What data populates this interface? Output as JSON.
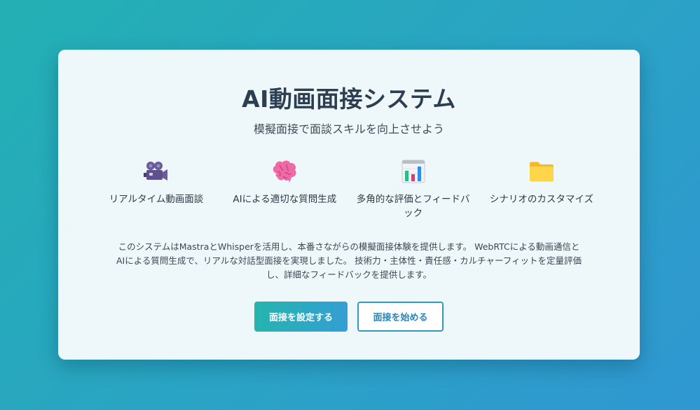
{
  "hero": {
    "title": "AI動画面接システム",
    "subtitle": "模擬面接で面談スキルを向上させよう"
  },
  "features": [
    {
      "icon": "movie-camera-icon",
      "label": "リアルタイム動画面談"
    },
    {
      "icon": "brain-icon",
      "label": "AIによる適切な質問生成"
    },
    {
      "icon": "bar-chart-icon",
      "label": "多角的な評価とフィードバック"
    },
    {
      "icon": "folder-icon",
      "label": "シナリオのカスタマイズ"
    }
  ],
  "description": "このシステムはMastraとWhisperを活用し、本番さながらの模擬面接体験を提供します。 WebRTCによる動画通信とAIによる質問生成で、リアルな対話型面接を実現しました。 技術力・主体性・責任感・カルチャーフィットを定量評価し、詳細なフィードバックを提供します。",
  "actions": {
    "configure_label": "面接を設定する",
    "start_label": "面接を始める"
  },
  "colors": {
    "background_start": "#23b0b3",
    "background_end": "#2f97d1",
    "card": "#eef8fb",
    "title": "#2c3e50",
    "primary_button_start": "#27b3ae",
    "primary_button_end": "#339fd4",
    "secondary_button_text": "#2a86b8"
  }
}
